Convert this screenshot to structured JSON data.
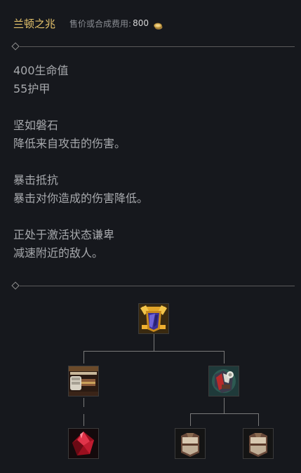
{
  "item": {
    "title": "兰顿之兆",
    "cost_label": "售价或合成费用:",
    "cost_value": "800",
    "coin_icon": "gold-coin-icon"
  },
  "stats": [
    "400生命值",
    "55护甲"
  ],
  "passives": [
    {
      "name": "坚如磐石",
      "text": "降低来自攻击的伤害。"
    },
    {
      "name": "暴击抵抗",
      "text": "暴击对你造成的伤害降低。"
    }
  ],
  "active": {
    "name": "正处于激活状态谦卑",
    "text": "减速附近的敌人。"
  },
  "recipe_tree": {
    "root": {
      "name": "兰顿之兆",
      "icon": "randuins-omen-icon"
    },
    "components": [
      {
        "name": "warden-mail",
        "icon": "warden-mail-icon"
      },
      {
        "name": "giants-belt",
        "icon": "giants-belt-icon"
      }
    ],
    "sub_components": [
      {
        "name": "ruby-crystal",
        "icon": "ruby-crystal-icon"
      },
      {
        "name": "cloth-armor",
        "icon": "cloth-armor-icon"
      },
      {
        "name": "cloth-armor",
        "icon": "cloth-armor-icon"
      }
    ]
  },
  "colors": {
    "background": "#16181d",
    "title_gold": "#e6c46c",
    "text": "#a7a9ad",
    "divider": "#5a5a5a"
  }
}
